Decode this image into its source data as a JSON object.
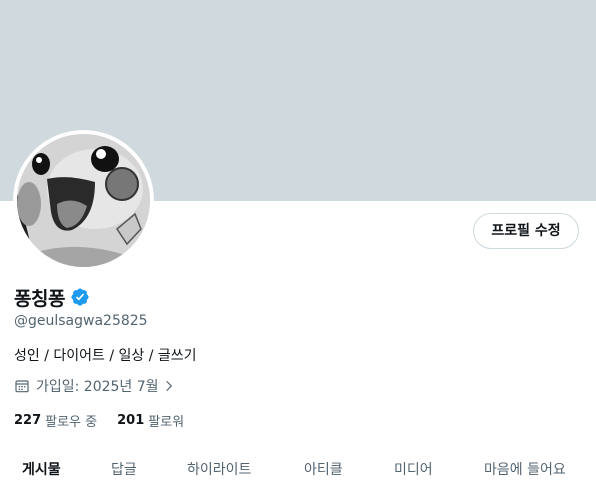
{
  "profile": {
    "display_name": "퐁칭퐁",
    "handle": "@geulsagwa25825",
    "bio": "성인 / 다이어트 / 일상 / 글쓰기",
    "joined": "가입일: 2025년 7월",
    "following_count": "227",
    "following_label": "팔로우 중",
    "followers_count": "201",
    "followers_label": "팔로워",
    "verified": true
  },
  "actions": {
    "edit_profile": "프로필 수정"
  },
  "tabs": [
    {
      "label": "게시물",
      "active": true
    },
    {
      "label": "답글",
      "active": false
    },
    {
      "label": "하이라이트",
      "active": false
    },
    {
      "label": "아티클",
      "active": false
    },
    {
      "label": "미디어",
      "active": false
    },
    {
      "label": "마음에 들어요",
      "active": false
    }
  ],
  "colors": {
    "banner": "#cfd9de",
    "verified_badge": "#1d9bf0",
    "secondary_text": "#536471",
    "primary_text": "#0f1419"
  },
  "icons": [
    "verified-badge-icon",
    "calendar-icon",
    "chevron-right-icon"
  ]
}
